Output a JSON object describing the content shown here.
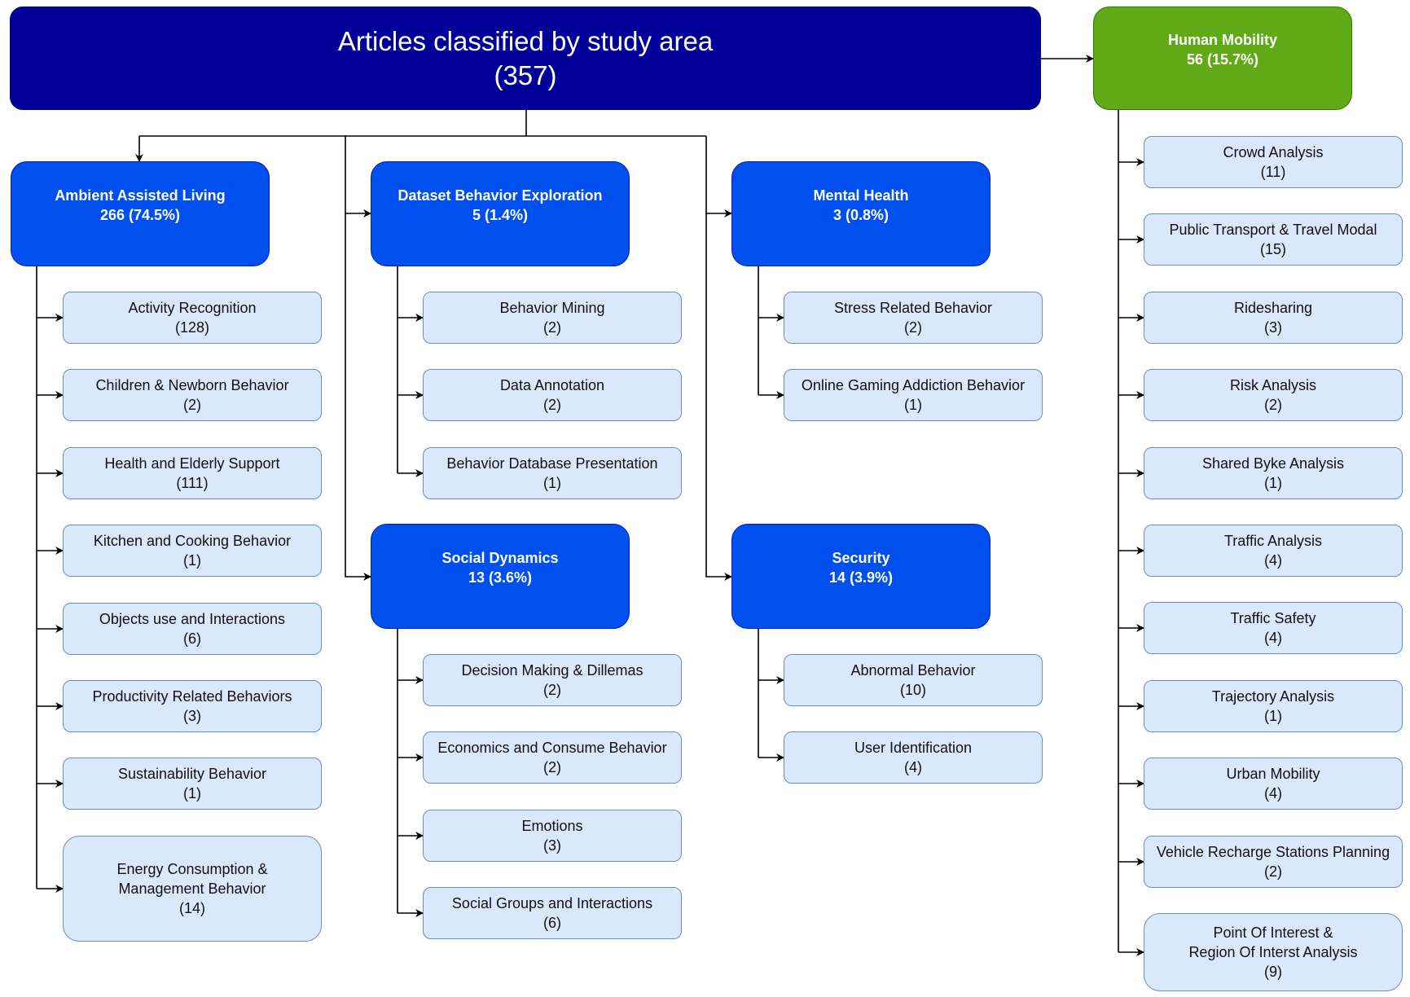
{
  "root": {
    "title": "Articles classified by study area",
    "count": "(357)"
  },
  "categories": [
    {
      "id": "ambient-assisted-living",
      "name": "Ambient Assisted Living",
      "stats": "266 (74.5%)",
      "color": "#0050ef",
      "children": [
        {
          "lines": [
            "Activity Recognition"
          ],
          "count": "(128)"
        },
        {
          "lines": [
            "Children & Newborn Behavior"
          ],
          "count": "(2)"
        },
        {
          "lines": [
            "Health and Elderly Support"
          ],
          "count": "(111)"
        },
        {
          "lines": [
            "Kitchen and Cooking Behavior"
          ],
          "count": "(1)"
        },
        {
          "lines": [
            "Objects use and Interactions"
          ],
          "count": "(6)"
        },
        {
          "lines": [
            "Productivity Related Behaviors"
          ],
          "count": "(3)"
        },
        {
          "lines": [
            "Sustainability Behavior"
          ],
          "count": "(1)"
        },
        {
          "lines": [
            "Energy Consumption &",
            "Management Behavior"
          ],
          "count": "(14)"
        }
      ]
    },
    {
      "id": "dataset-behavior-exploration",
      "name": "Dataset Behavior Exploration",
      "stats": "5 (1.4%)",
      "color": "#0050ef",
      "children": [
        {
          "lines": [
            "Behavior Mining"
          ],
          "count": "(2)"
        },
        {
          "lines": [
            "Data Annotation"
          ],
          "count": "(2)"
        },
        {
          "lines": [
            "Behavior Database Presentation"
          ],
          "count": "(1)"
        }
      ]
    },
    {
      "id": "mental-health",
      "name": "Mental Health",
      "stats": "3 (0.8%)",
      "color": "#0050ef",
      "children": [
        {
          "lines": [
            "Stress Related Behavior"
          ],
          "count": "(2)"
        },
        {
          "lines": [
            "Online Gaming Addiction Behavior"
          ],
          "count": "(1)"
        }
      ]
    },
    {
      "id": "social-dynamics",
      "name": "Social Dynamics",
      "stats": "13 (3.6%)",
      "color": "#0050ef",
      "children": [
        {
          "lines": [
            "Decision Making & Dillemas"
          ],
          "count": "(2)"
        },
        {
          "lines": [
            "Economics and Consume Behavior"
          ],
          "count": "(2)"
        },
        {
          "lines": [
            "Emotions"
          ],
          "count": "(3)"
        },
        {
          "lines": [
            "Social Groups and Interactions"
          ],
          "count": "(6)"
        }
      ]
    },
    {
      "id": "security",
      "name": "Security",
      "stats": "14 (3.9%)",
      "color": "#0050ef",
      "children": [
        {
          "lines": [
            "Abnormal Behavior"
          ],
          "count": "(10)"
        },
        {
          "lines": [
            "User Identification"
          ],
          "count": "(4)"
        }
      ]
    },
    {
      "id": "human-mobility",
      "name": "Human Mobility",
      "stats": "56 (15.7%)",
      "color": "#60a917",
      "children": [
        {
          "lines": [
            "Crowd Analysis"
          ],
          "count": "(11)"
        },
        {
          "lines": [
            "Public Transport & Travel Modal"
          ],
          "count": "(15)"
        },
        {
          "lines": [
            "Ridesharing"
          ],
          "count": "(3)"
        },
        {
          "lines": [
            "Risk Analysis"
          ],
          "count": "(2)"
        },
        {
          "lines": [
            "Shared Byke Analysis"
          ],
          "count": "(1)"
        },
        {
          "lines": [
            "Traffic Analysis"
          ],
          "count": "(4)"
        },
        {
          "lines": [
            "Traffic Safety"
          ],
          "count": "(4)"
        },
        {
          "lines": [
            "Trajectory Analysis"
          ],
          "count": "(1)"
        },
        {
          "lines": [
            "Urban Mobility"
          ],
          "count": "(4)"
        },
        {
          "lines": [
            "Vehicle Recharge Stations Planning"
          ],
          "count": "(2)"
        },
        {
          "lines": [
            "Point Of Interest &",
            "Region Of Interst Analysis"
          ],
          "count": "(9)"
        }
      ]
    }
  ],
  "colors": {
    "root": "#000099",
    "category": "#0050ef",
    "human_mobility": "#60a917",
    "leaf_fill": "#dae8fc",
    "leaf_border": "#6c8ebf",
    "connector": "#000000"
  }
}
